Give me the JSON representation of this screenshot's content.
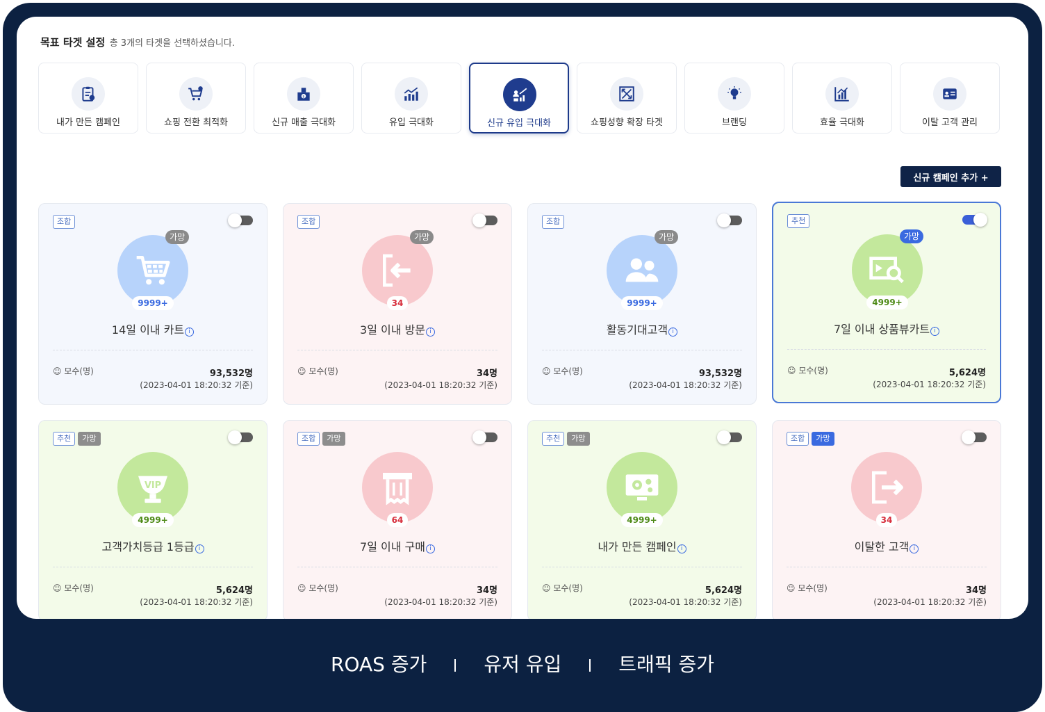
{
  "header": {
    "title": "목표 타겟 설정",
    "subtitle": "총 3개의 타겟을 선택하셨습니다."
  },
  "targets": [
    {
      "label": "내가 만든 캠페인",
      "icon": "clipboard-icon",
      "active": false
    },
    {
      "label": "쇼핑 전환 최적화",
      "icon": "cart-icon",
      "active": false
    },
    {
      "label": "신규 매출 극대화",
      "icon": "money-building-icon",
      "active": false
    },
    {
      "label": "유입 극대화",
      "icon": "growth-chart-icon",
      "active": false
    },
    {
      "label": "신규 유입 극대화",
      "icon": "people-growth-icon",
      "active": true
    },
    {
      "label": "쇼핑성향 확장 타겟",
      "icon": "expand-icon",
      "active": false
    },
    {
      "label": "브랜딩",
      "icon": "lightbulb-icon",
      "active": false
    },
    {
      "label": "효율 극대화",
      "icon": "bar-chart-icon",
      "active": false
    },
    {
      "label": "이탈 고객 관리",
      "icon": "id-card-icon",
      "active": false
    }
  ],
  "add_button": "신규 캠페인 추가 +",
  "cards": [
    {
      "tags": [
        "조합"
      ],
      "top_badge": "가망",
      "count": "9999+",
      "title": "14일 이내 카트",
      "pop_label": "모수(명)",
      "pop_value": "93,532명",
      "date": "(2023-04-01 18:20:32 기준)",
      "toggle": "off",
      "icon": "cart-icon"
    },
    {
      "tags": [
        "조합"
      ],
      "top_badge": "가망",
      "count": "34",
      "title": "3일 이내 방문",
      "pop_label": "모수(명)",
      "pop_value": "34명",
      "date": "(2023-04-01 18:20:32 기준)",
      "toggle": "off",
      "icon": "enter-icon"
    },
    {
      "tags": [
        "조합"
      ],
      "top_badge": "가망",
      "count": "9999+",
      "title": "활동기대고객",
      "pop_label": "모수(명)",
      "pop_value": "93,532명",
      "date": "(2023-04-01 18:20:32 기준)",
      "toggle": "off",
      "icon": "users-icon"
    },
    {
      "tags": [
        "추천"
      ],
      "top_badge": "가망",
      "count": "4999+",
      "title": "7일 이내 상품뷰카트",
      "pop_label": "모수(명)",
      "pop_value": "5,624명",
      "date": "(2023-04-01 18:20:32 기준)",
      "toggle": "on",
      "icon": "product-view-icon"
    },
    {
      "tags": [
        "추천",
        "가망"
      ],
      "count": "4999+",
      "title": "고객가치등급 1등급",
      "pop_label": "모수(명)",
      "pop_value": "5,624명",
      "date": "(2023-04-01 18:20:32 기준)",
      "toggle": "off",
      "icon": "vip-trophy-icon"
    },
    {
      "tags": [
        "조합",
        "가망"
      ],
      "count": "64",
      "title": "7일 이내 구매",
      "pop_label": "모수(명)",
      "pop_value": "34명",
      "date": "(2023-04-01 18:20:32 기준)",
      "toggle": "off",
      "icon": "receipt-icon"
    },
    {
      "tags": [
        "추천",
        "가망"
      ],
      "count": "4999+",
      "title": "내가 만든 캠페인",
      "pop_label": "모수(명)",
      "pop_value": "5,624명",
      "date": "(2023-04-01 18:20:32 기준)",
      "toggle": "off",
      "icon": "settings-monitor-icon"
    },
    {
      "tags": [
        "조합",
        "가망"
      ],
      "count": "34",
      "title": "이탈한 고객",
      "pop_label": "모수(명)",
      "pop_value": "34명",
      "date": "(2023-04-01 18:20:32 기준)",
      "toggle": "off",
      "icon": "exit-icon"
    }
  ],
  "footer": {
    "items": [
      "ROAS 증가",
      "유저 유입",
      "트래픽 증가"
    ]
  },
  "colors": {
    "navy": "#0c2141",
    "accent": "#3a6ae0",
    "blue_card": "#f4f7fd",
    "pink_card": "#fdf3f4",
    "green_card": "#f3fbe9"
  }
}
